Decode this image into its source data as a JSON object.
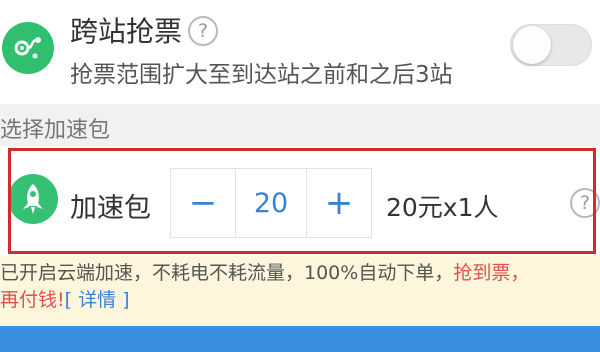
{
  "cross_station": {
    "icon": "route-pin-icon",
    "title": "跨站抢票",
    "help": "?",
    "description": "抢票范围扩大至到达站之前和之后3站",
    "toggle_on": false
  },
  "section_label": "选择加速包",
  "accelerator": {
    "icon": "rocket-icon",
    "label": "加速包",
    "minus": "−",
    "value": "20",
    "plus": "+",
    "price": "20元x1人",
    "help": "?"
  },
  "notice": {
    "part1": "已开启云端加速，不耗电不耗流量，100%自动下单，",
    "part2_red": "抢到票，",
    "part3_red": "再付钱!",
    "link": "[ 详情 ]"
  },
  "colors": {
    "accent_green": "#2fbf6f",
    "accent_blue": "#3a82d6",
    "highlight_red": "#d62a2a",
    "notice_bg": "#fdf5dc",
    "bottom_bar": "#3c8ee2"
  }
}
